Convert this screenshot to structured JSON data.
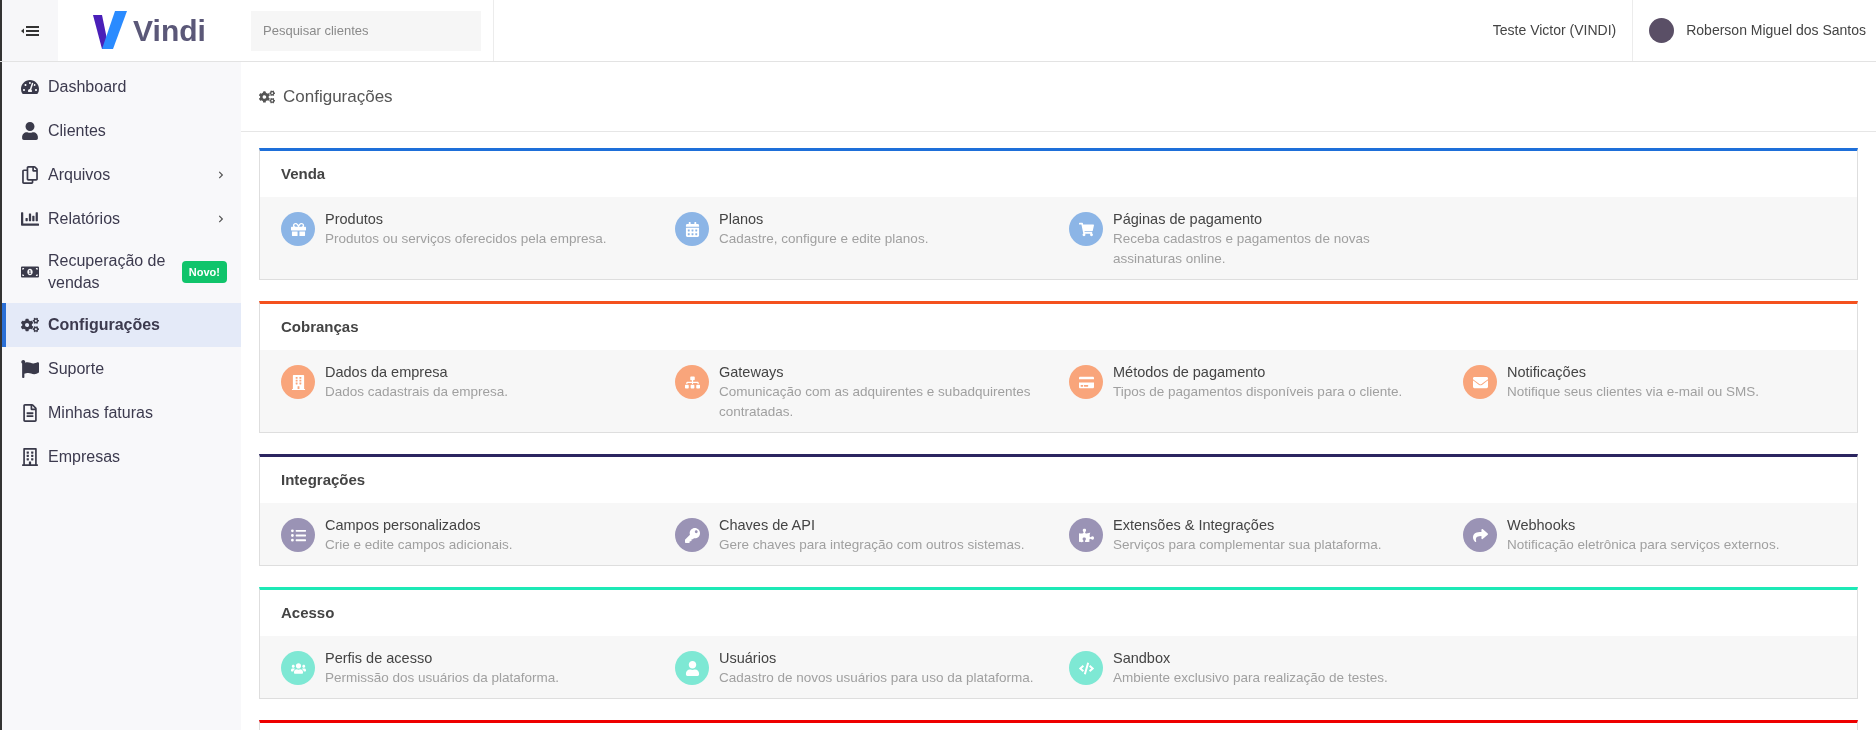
{
  "header": {
    "logo": "Vindi",
    "search": {
      "placeholder": "Pesquisar clientes"
    },
    "account": "Teste Victor (VINDI)",
    "user": "Roberson Miguel dos Santos"
  },
  "sidebar": {
    "items": [
      {
        "label": "Dashboard",
        "selected": false,
        "expandable": false
      },
      {
        "label": "Clientes",
        "selected": false,
        "expandable": false
      },
      {
        "label": "Arquivos",
        "selected": false,
        "expandable": true
      },
      {
        "label": "Relatórios",
        "selected": false,
        "expandable": true
      },
      {
        "label": "Recuperação de vendas",
        "selected": false,
        "expandable": false,
        "badge": "Novo!"
      },
      {
        "label": "Configurações",
        "selected": true,
        "expandable": false
      },
      {
        "label": "Suporte",
        "selected": false,
        "expandable": false
      },
      {
        "label": "Minhas faturas",
        "selected": false,
        "expandable": false
      },
      {
        "label": "Empresas",
        "selected": false,
        "expandable": false
      }
    ]
  },
  "page": {
    "title": "Configurações"
  },
  "sections": [
    {
      "title": "Venda",
      "color": "#1e6fd9",
      "items": [
        {
          "title": "Produtos",
          "description": "Produtos ou serviços oferecidos pela empresa."
        },
        {
          "title": "Planos",
          "description": "Cadastre, configure e edite planos."
        },
        {
          "title": "Páginas de pagamento",
          "description": "Receba cadastros e pagamentos de novas assinaturas online."
        }
      ]
    },
    {
      "title": "Cobranças",
      "color": "#f4511e",
      "items": [
        {
          "title": "Dados da empresa",
          "description": "Dados cadastrais da empresa."
        },
        {
          "title": "Gateways",
          "description": "Comunicação com as adquirentes e subadquirentes contratadas."
        },
        {
          "title": "Métodos de pagamento",
          "description": "Tipos de pagamentos disponíveis para o cliente."
        },
        {
          "title": "Notificações",
          "description": "Notifique seus clientes via e-mail ou SMS."
        }
      ]
    },
    {
      "title": "Integrações",
      "color": "#2b2560",
      "items": [
        {
          "title": "Campos personalizados",
          "description": "Crie e edite campos adicionais."
        },
        {
          "title": "Chaves de API",
          "description": "Gere chaves para integração com outros sistemas."
        },
        {
          "title": "Extensões & Integrações",
          "description": "Serviços para complementar sua plataforma."
        },
        {
          "title": "Webhooks",
          "description": "Notificação eletrônica para serviços externos."
        }
      ]
    },
    {
      "title": "Acesso",
      "color": "#1de9b6",
      "items": [
        {
          "title": "Perfis de acesso",
          "description": "Permissão dos usuários da plataforma."
        },
        {
          "title": "Usuários",
          "description": "Cadastro de novos usuários para uso da plataforma."
        },
        {
          "title": "Sandbox",
          "description": "Ambiente exclusivo para realização de testes."
        }
      ]
    },
    {
      "color": "#ee0000"
    }
  ]
}
